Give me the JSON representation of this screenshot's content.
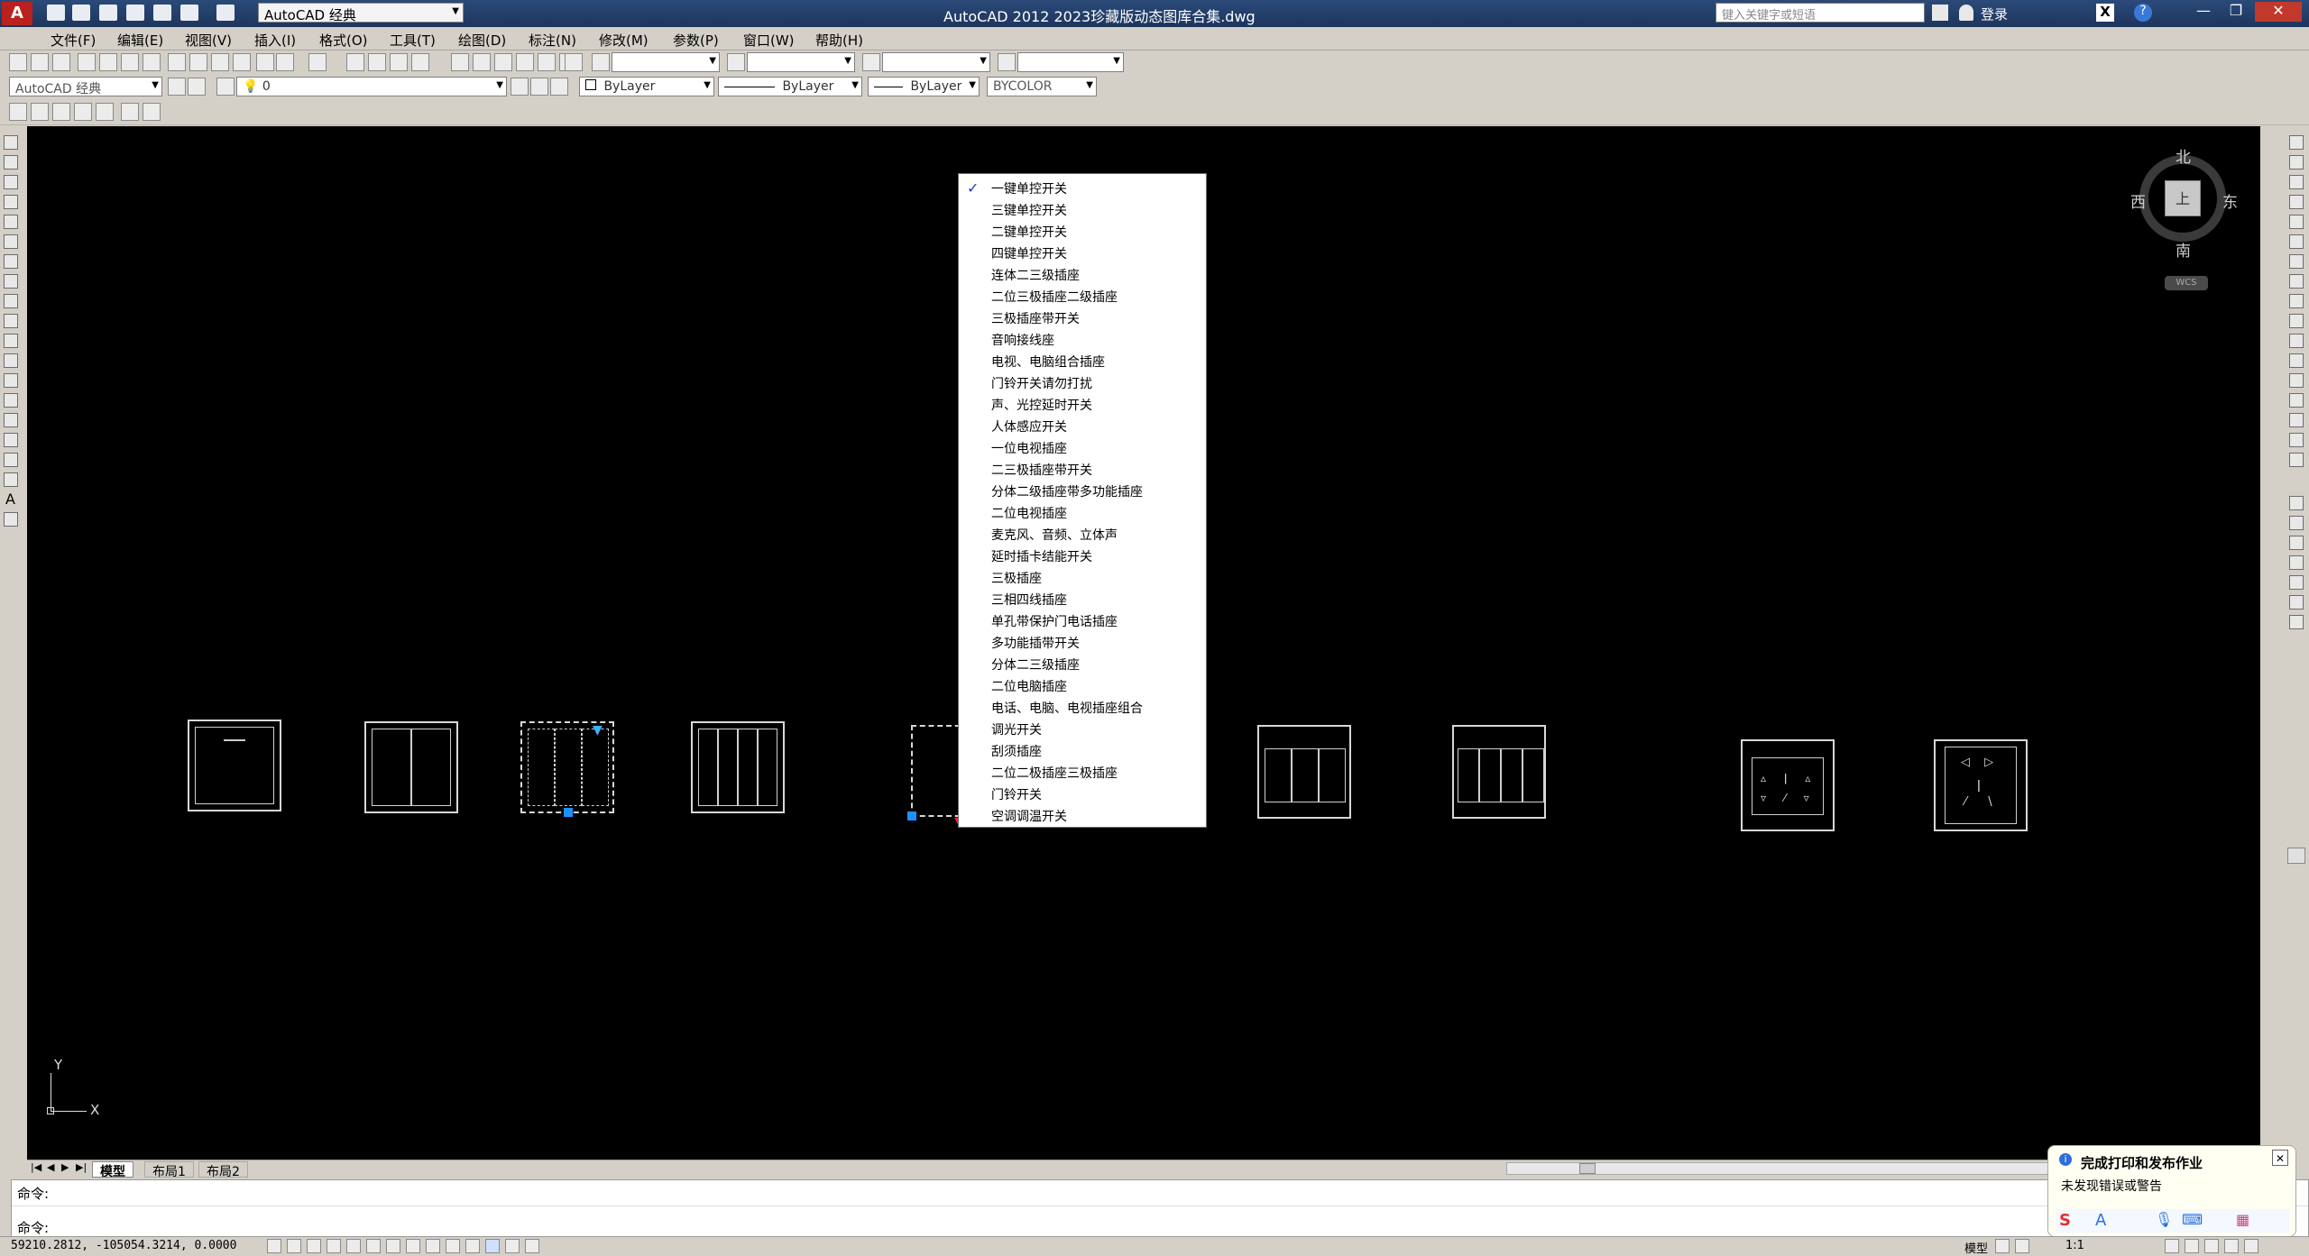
{
  "title_bar": {
    "workspace": "AutoCAD 经典",
    "title": "AutoCAD 2012    2023珍藏版动态图库合集.dwg",
    "search_placeholder": "键入关键字或短语",
    "login": "登录"
  },
  "menu": [
    "文件(F)",
    "编辑(E)",
    "视图(V)",
    "插入(I)",
    "格式(O)",
    "工具(T)",
    "绘图(D)",
    "标注(N)",
    "修改(M)",
    "参数(P)",
    "窗口(W)",
    "帮助(H)"
  ],
  "toolbars": {
    "workspace_combo": "AutoCAD 经典",
    "layer_combo": "0",
    "color_combo": "ByLayer",
    "linetype_combo": "ByLayer",
    "lineweight_combo": "ByLayer",
    "plotstyle_combo": "BYCOLOR"
  },
  "viewcube": {
    "north": "北",
    "south": "南",
    "east": "东",
    "west": "西",
    "top": "上",
    "wcs": "WCS"
  },
  "ucs": {
    "x": "X",
    "y": "Y"
  },
  "context_list": {
    "checked_index": 0,
    "items": [
      "一键单控开关",
      "三键单控开关",
      "二键单控开关",
      "四键单控开关",
      "连体二三级插座",
      "二位三极插座二级插座",
      "三极插座带开关",
      "音响接线座",
      "电视、电脑组合插座",
      "门铃开关请勿打扰",
      "声、光控延时开关",
      "人体感应开关",
      "一位电视插座",
      "二三极插座带开关",
      "分体二级插座带多功能插座",
      "二位电视插座",
      "麦克风、音频、立体声",
      "延时插卡结能开关",
      "三极插座",
      "三相四线插座",
      "单孔带保护门电话插座",
      "多功能插带开关",
      "分体二三级插座",
      "二位电脑插座",
      "电话、电脑、电视插座组合",
      "调光开关",
      "刮须插座",
      "二位二极插座三极插座",
      "门铃开关",
      "空调调温开关"
    ]
  },
  "layout_tabs": [
    "模型",
    "布局1",
    "布局2"
  ],
  "command": {
    "line1": "命令:",
    "line2": "命令:"
  },
  "status": {
    "coords": "59210.2812, -105054.3214, 0.0000",
    "model": "模型",
    "scale": "1:1"
  },
  "notification": {
    "title": "完成打印和发布作业",
    "body": "未发现错误或警告"
  },
  "colors": {
    "canvas": "#000000",
    "grip": "#1e90ff",
    "arrow": "#ff2020",
    "titlebar": "#1d355c"
  }
}
